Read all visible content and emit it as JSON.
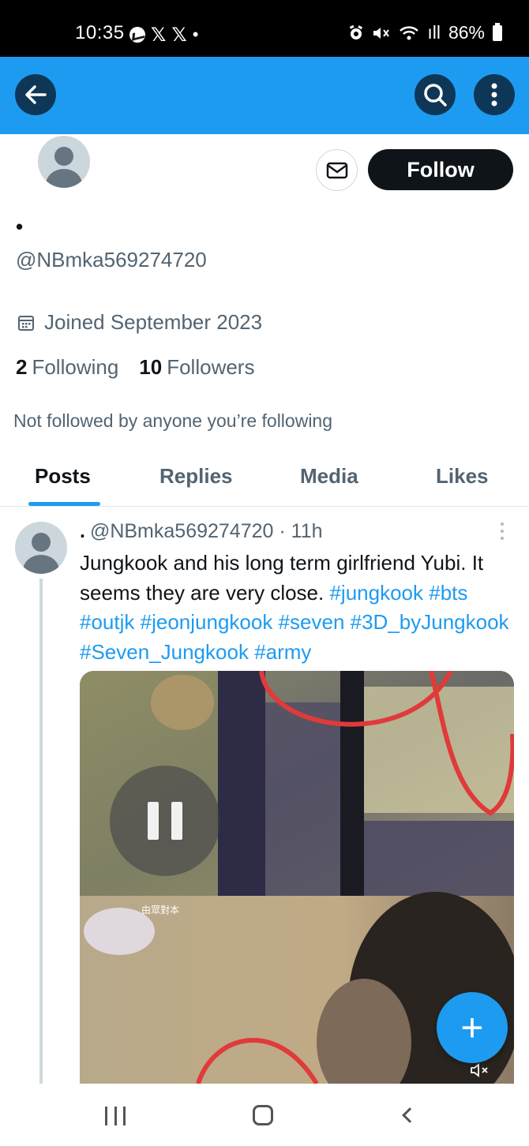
{
  "status_bar": {
    "time": "10:35",
    "x_glyph": "𝕏",
    "dot": "•",
    "signal_text": "ıll",
    "battery": "86%"
  },
  "profile": {
    "display_name": "•",
    "handle": "@NBmka569274720",
    "joined": "Joined September 2023",
    "following_count": "2",
    "following_label": "Following",
    "followers_count": "10",
    "followers_label": "Followers",
    "not_followed_text": "Not followed by anyone you’re following",
    "follow_button": "Follow"
  },
  "tabs": [
    {
      "label": "Posts",
      "active": true
    },
    {
      "label": "Replies",
      "active": false
    },
    {
      "label": "Media",
      "active": false
    },
    {
      "label": "Likes",
      "active": false
    }
  ],
  "tweet": {
    "name": ".",
    "meta": "@NBmka569274720 · 11h",
    "text_part1": "Jungkook and his long term girlfriend Yubi. It seems they are very close. ",
    "hashtags": [
      "#jungkook",
      "#bts",
      "#outjk",
      "#jeonjungkook",
      "#seven",
      "#3D_byJungkook",
      "#Seven_Jungkook",
      "#army"
    ],
    "video_logo_text": "由眾對本"
  },
  "fab_label": "+",
  "colors": {
    "accent": "#1d9bf0",
    "appbar_button": "#0e3757",
    "text_primary": "#0f1419",
    "text_secondary": "#536471"
  }
}
